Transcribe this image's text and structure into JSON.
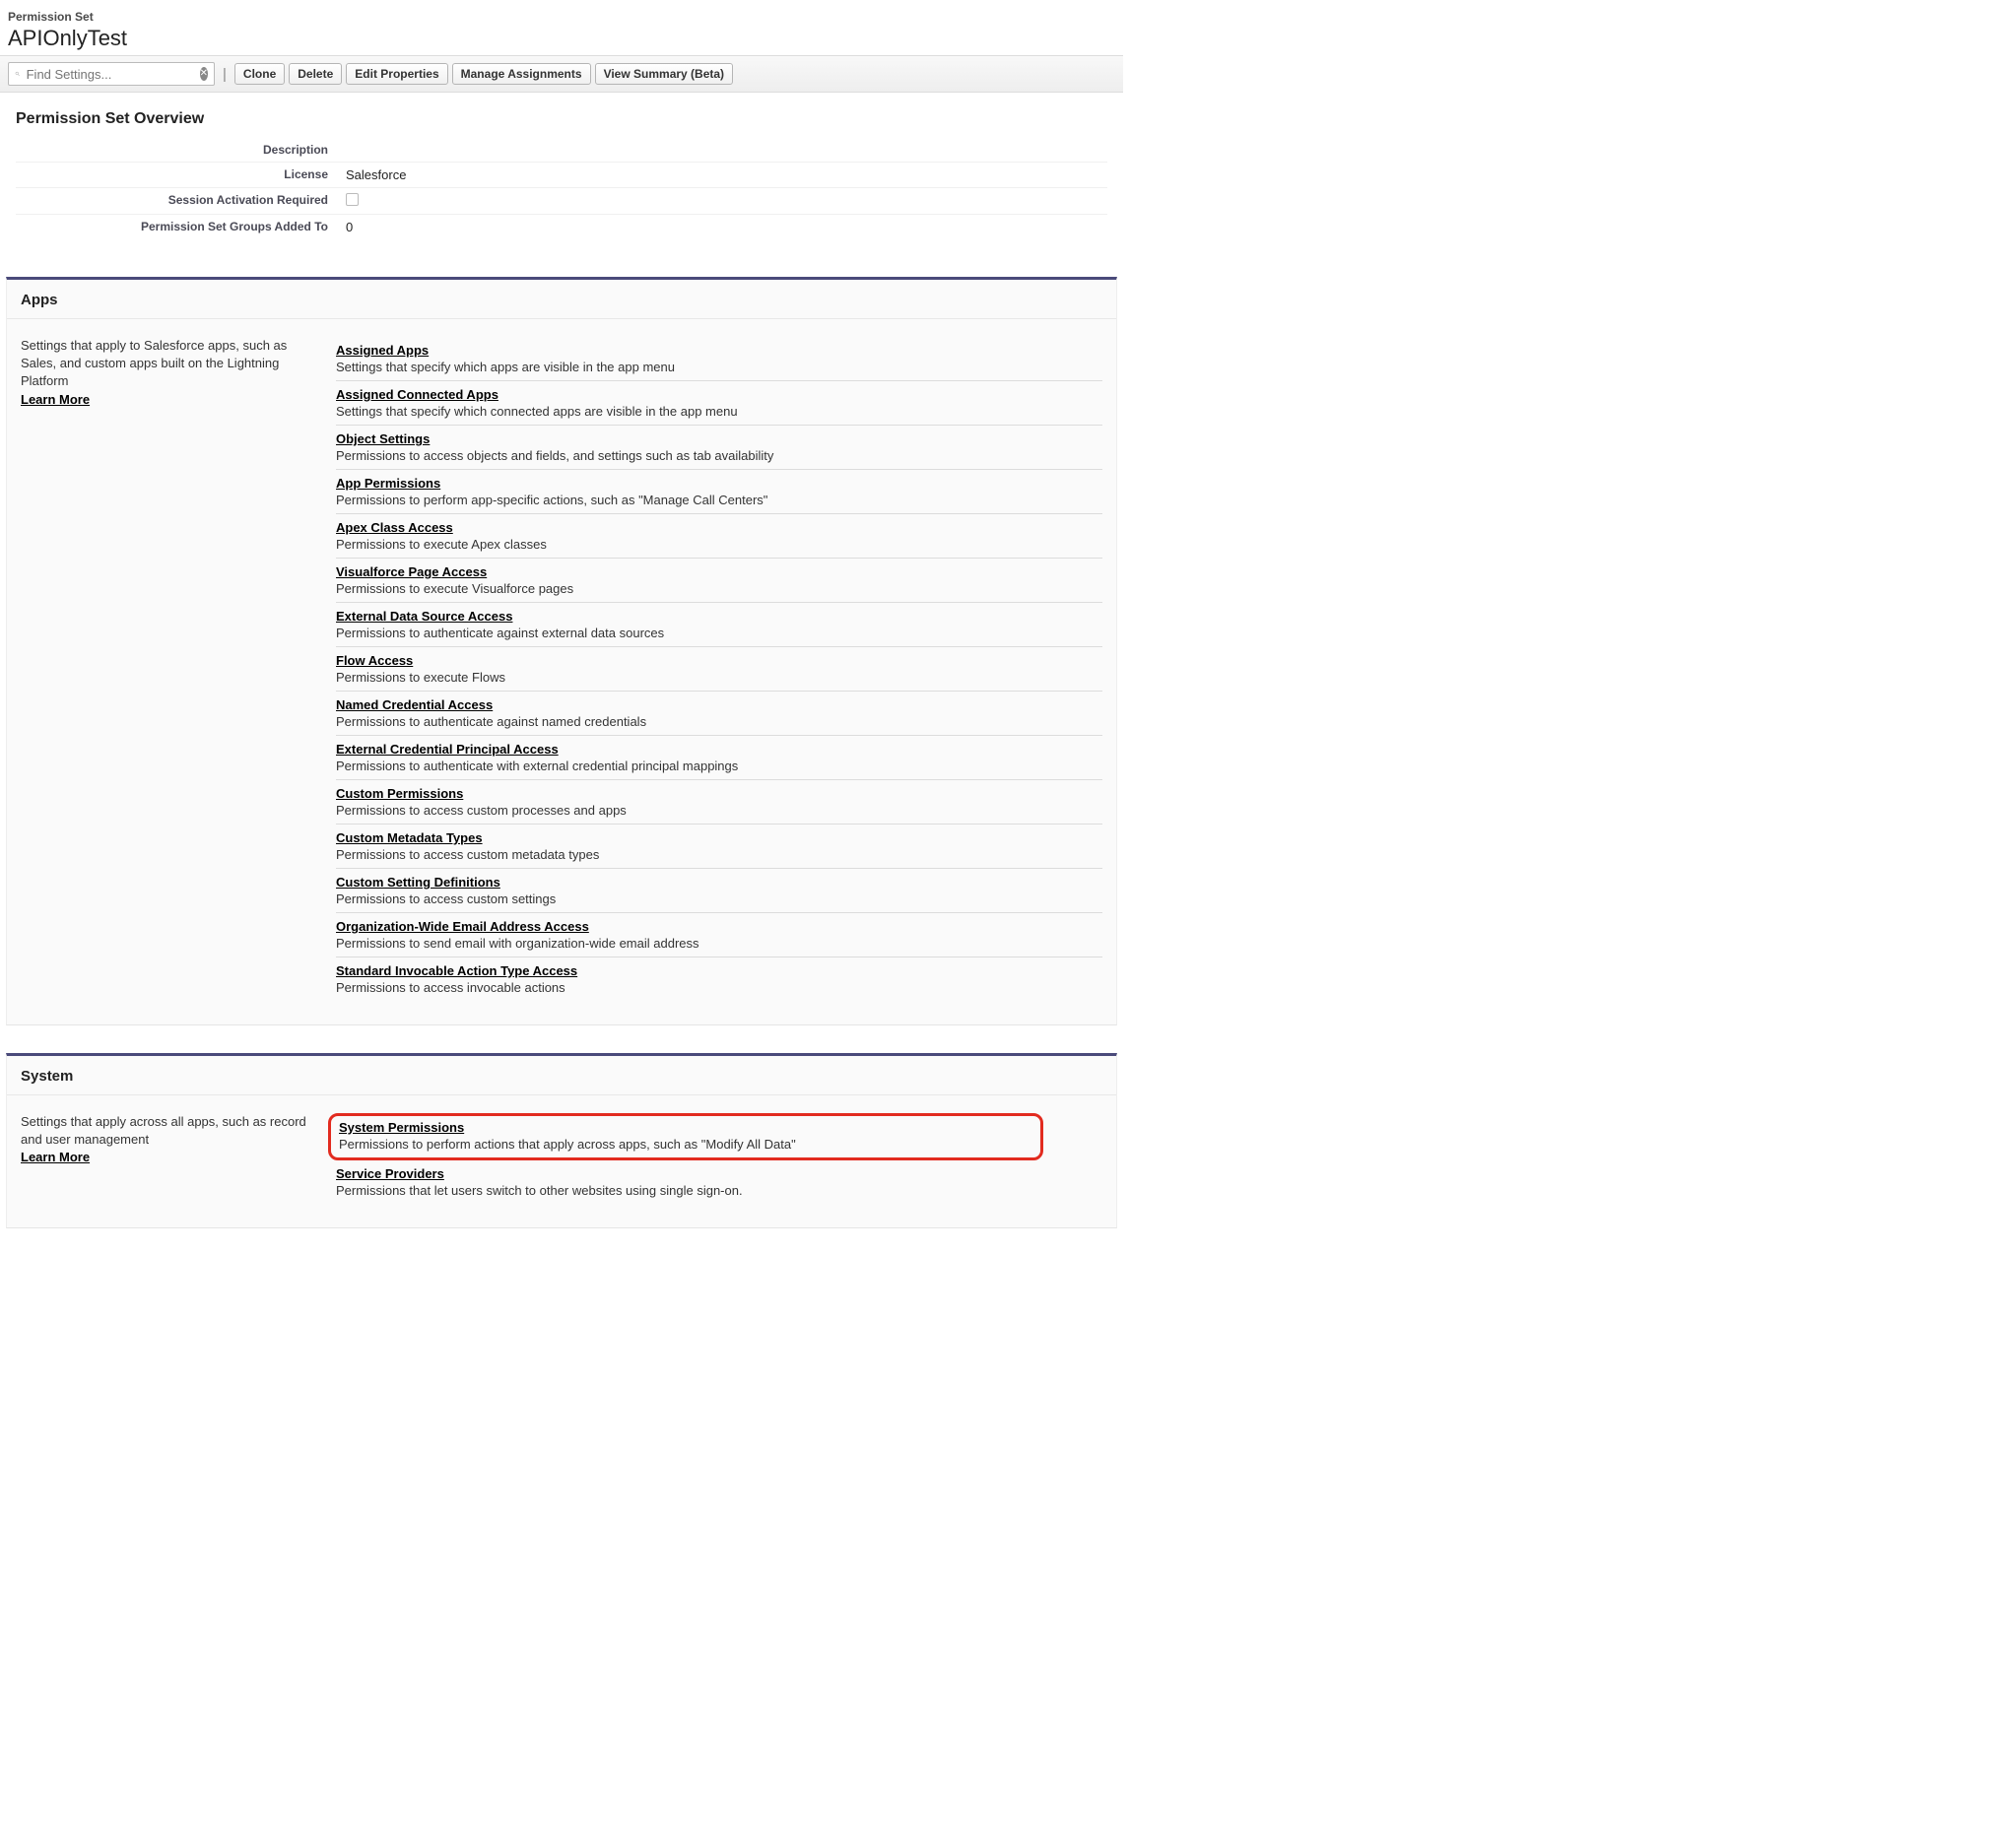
{
  "header": {
    "label": "Permission Set",
    "title": "APIOnlyTest"
  },
  "toolbar": {
    "search_placeholder": "Find Settings...",
    "clone": "Clone",
    "delete": "Delete",
    "edit_properties": "Edit Properties",
    "manage_assignments": "Manage Assignments",
    "view_summary": "View Summary (Beta)"
  },
  "overview": {
    "heading": "Permission Set Overview",
    "rows": {
      "description_label": "Description",
      "description_value": "",
      "license_label": "License",
      "license_value": "Salesforce",
      "session_label": "Session Activation Required",
      "groups_label": "Permission Set Groups Added To",
      "groups_value": "0"
    }
  },
  "apps": {
    "heading": "Apps",
    "intro": "Settings that apply to Salesforce apps, such as Sales, and custom apps built on the Lightning Platform",
    "learn_more": "Learn More",
    "items": [
      {
        "title": "Assigned Apps",
        "desc": "Settings that specify which apps are visible in the app menu"
      },
      {
        "title": "Assigned Connected Apps",
        "desc": "Settings that specify which connected apps are visible in the app menu"
      },
      {
        "title": "Object Settings",
        "desc": "Permissions to access objects and fields, and settings such as tab availability"
      },
      {
        "title": "App Permissions",
        "desc": "Permissions to perform app-specific actions, such as \"Manage Call Centers\""
      },
      {
        "title": "Apex Class Access",
        "desc": "Permissions to execute Apex classes"
      },
      {
        "title": "Visualforce Page Access",
        "desc": "Permissions to execute Visualforce pages"
      },
      {
        "title": "External Data Source Access",
        "desc": "Permissions to authenticate against external data sources"
      },
      {
        "title": "Flow Access",
        "desc": "Permissions to execute Flows"
      },
      {
        "title": "Named Credential Access",
        "desc": "Permissions to authenticate against named credentials"
      },
      {
        "title": "External Credential Principal Access",
        "desc": "Permissions to authenticate with external credential principal mappings"
      },
      {
        "title": "Custom Permissions",
        "desc": "Permissions to access custom processes and apps"
      },
      {
        "title": "Custom Metadata Types",
        "desc": "Permissions to access custom metadata types"
      },
      {
        "title": "Custom Setting Definitions",
        "desc": "Permissions to access custom settings"
      },
      {
        "title": "Organization-Wide Email Address Access",
        "desc": "Permissions to send email with organization-wide email address"
      },
      {
        "title": "Standard Invocable Action Type Access",
        "desc": "Permissions to access invocable actions"
      }
    ]
  },
  "system": {
    "heading": "System",
    "intro": "Settings that apply across all apps, such as record and user management",
    "learn_more": "Learn More",
    "items": [
      {
        "title": "System Permissions",
        "desc": "Permissions to perform actions that apply across apps, such as \"Modify All Data\"",
        "highlight": true
      },
      {
        "title": "Service Providers",
        "desc": "Permissions that let users switch to other websites using single sign-on."
      }
    ]
  }
}
